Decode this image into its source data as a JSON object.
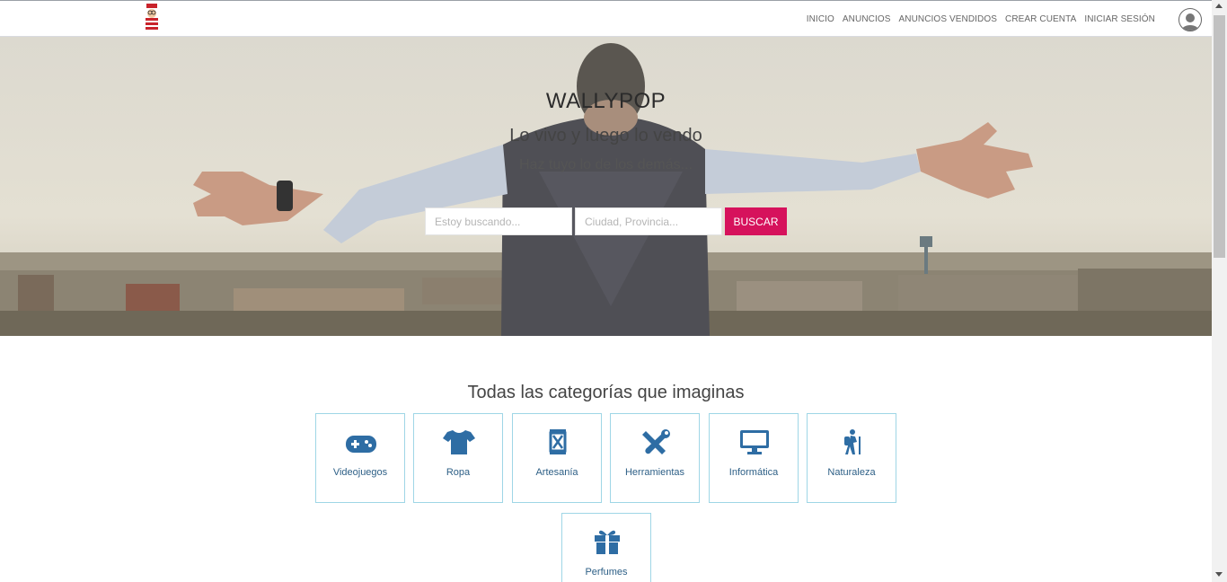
{
  "nav": {
    "links": [
      "INICIO",
      "ANUNCIOS",
      "ANUNCIOS VENDIDOS",
      "CREAR CUENTA",
      "INICIAR SESIÓN"
    ]
  },
  "hero": {
    "title": "WALLYPOP",
    "subtitle": "Lo vivo y luego lo vendo",
    "tagline": "Haz tuyo lo de los demás...",
    "search_placeholder": "Estoy buscando...",
    "location_placeholder": "Ciudad, Provincia...",
    "search_button": "BUSCAR"
  },
  "categories": {
    "heading": "Todas las categorías que imaginas",
    "items": [
      {
        "label": "Videojuegos",
        "icon": "gamepad-icon"
      },
      {
        "label": "Ropa",
        "icon": "tshirt-icon"
      },
      {
        "label": "Artesanía",
        "icon": "hourglass-icon"
      },
      {
        "label": "Herramientas",
        "icon": "tools-icon"
      },
      {
        "label": "Informática",
        "icon": "desktop-icon"
      },
      {
        "label": "Naturaleza",
        "icon": "hiking-icon"
      },
      {
        "label": "Perfumes",
        "icon": "gift-icon"
      }
    ]
  },
  "colors": {
    "accent": "#d6125c",
    "icon": "#2e6da4",
    "card_border": "#9fd6e6"
  }
}
